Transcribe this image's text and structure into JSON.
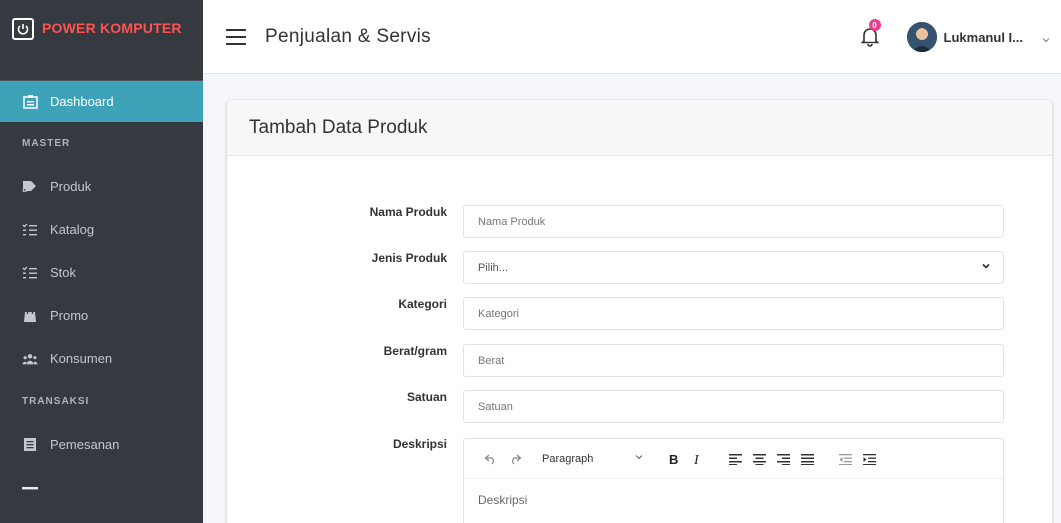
{
  "brand": {
    "name": "POWER KOMPUTER"
  },
  "sidebar": {
    "items": [
      {
        "label": "Dashboard",
        "icon": "dashboard-icon",
        "active": true
      },
      {
        "header": "MASTER"
      },
      {
        "label": "Produk",
        "icon": "product-icon"
      },
      {
        "label": "Katalog",
        "icon": "list-icon"
      },
      {
        "label": "Stok",
        "icon": "list-icon"
      },
      {
        "label": "Promo",
        "icon": "shopping-bag-icon"
      },
      {
        "label": "Konsumen",
        "icon": "users-icon"
      },
      {
        "header": "TRANSAKSI"
      },
      {
        "label": "Pemesanan",
        "icon": "document-icon"
      }
    ]
  },
  "header": {
    "title": "Penjualan & Servis",
    "notification_count": "0",
    "user_name": "Lukmanul I..."
  },
  "form": {
    "title": "Tambah Data Produk",
    "fields": {
      "nama_produk": {
        "label": "Nama Produk",
        "placeholder": "Nama Produk"
      },
      "jenis_produk": {
        "label": "Jenis Produk",
        "selected": "Pilih..."
      },
      "kategori": {
        "label": "Kategori",
        "placeholder": "Kategori"
      },
      "berat": {
        "label": "Berat/gram",
        "placeholder": "Berat"
      },
      "satuan": {
        "label": "Satuan",
        "placeholder": "Satuan"
      },
      "deskripsi": {
        "label": "Deskripsi",
        "placeholder": "Deskripsi"
      }
    },
    "editor": {
      "block_format": "Paragraph"
    }
  },
  "colors": {
    "sidebar_bg": "#343a40",
    "active_item": "#3ea3b8",
    "brand_text": "#ff5252",
    "badge": "#e83e8c"
  }
}
